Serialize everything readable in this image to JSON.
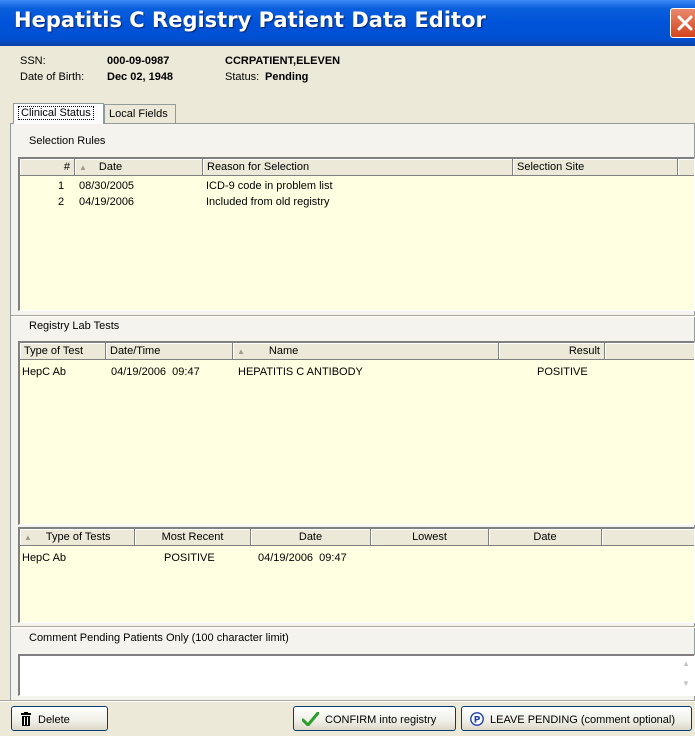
{
  "window": {
    "title": "Hepatitis C Registry Patient Data Editor"
  },
  "patient": {
    "ssn_label": "SSN:",
    "ssn": "000-09-0987",
    "dob_label": "Date of Birth:",
    "dob": "Dec 02, 1948",
    "name": "CCRPATIENT,ELEVEN",
    "status_label": "Status:",
    "status": "Pending"
  },
  "tabs": [
    {
      "label": "Clinical Status",
      "active": true
    },
    {
      "label": "Local Fields",
      "active": false
    }
  ],
  "selection_rules": {
    "label": "Selection Rules",
    "columns": [
      "#",
      "Date",
      "Reason for Selection",
      "Selection Site"
    ],
    "rows": [
      {
        "num": "1",
        "date": "08/30/2005",
        "reason": "ICD-9 code in problem list",
        "site": ""
      },
      {
        "num": "2",
        "date": "04/19/2006",
        "reason": "Included from old registry",
        "site": ""
      }
    ]
  },
  "lab_tests": {
    "label": "Registry Lab Tests",
    "columns": [
      "Type of Test",
      "Date/Time",
      "Name",
      "Result"
    ],
    "rows": [
      {
        "type": "HepC Ab",
        "datetime": "04/19/2006  09:47",
        "name": "HEPATITIS C ANTIBODY",
        "result": "POSITIVE"
      }
    ]
  },
  "summary": {
    "columns": [
      "Type of Tests",
      "Most Recent",
      "Date",
      "Lowest",
      "Date"
    ],
    "rows": [
      {
        "type": "HepC Ab",
        "recent": "POSITIVE",
        "date": "04/19/2006  09:47",
        "lowest": "",
        "date2": ""
      }
    ]
  },
  "comment": {
    "label": "Comment Pending Patients Only (100 character limit)",
    "value": ""
  },
  "buttons": {
    "delete": "Delete",
    "confirm": "CONFIRM into registry",
    "leave_pending": "LEAVE PENDING (comment optional)"
  },
  "colors": {
    "title_bar": "#0053d9",
    "grid_background": "#ffffe1",
    "confirm_check": "#2a9d2a",
    "pending_icon": "#1c3fa8"
  },
  "icons": {
    "close": "close-icon",
    "delete": "trash-icon",
    "confirm": "checkmark-icon",
    "leave_pending": "p-circle-icon"
  }
}
